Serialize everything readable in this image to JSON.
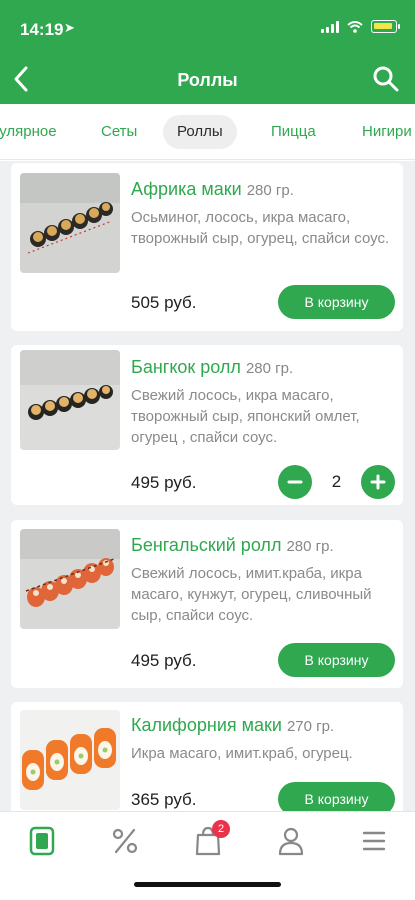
{
  "status": {
    "time": "14:19"
  },
  "header": {
    "title": "Роллы",
    "back_icon": "chevron-left-icon",
    "search_icon": "search-icon"
  },
  "tabs": [
    {
      "label": "Популярное"
    },
    {
      "label": "Сеты"
    },
    {
      "label": "Роллы",
      "active": true
    },
    {
      "label": "Пицца"
    },
    {
      "label": "Нигири"
    }
  ],
  "products": [
    {
      "name": "Африка маки",
      "weight": "280 гр.",
      "description": "Осьминог, лосось, икра масаго, творожный сыр, огурец, спайси соус.",
      "price": "505 руб.",
      "action": "В корзину"
    },
    {
      "name": "Бангкок ролл",
      "weight": "280 гр.",
      "description": "Свежий лосось, икра масаго, творожный сыр, японский омлет, огурец , спайси соус.",
      "price": "495 руб.",
      "quantity": "2"
    },
    {
      "name": "Бенгальский ролл",
      "weight": "280 гр.",
      "description": "Свежий лосось, имит.краба, икра масаго, кунжут, огурец, сливочный сыр, спайси соус.",
      "price": "495 руб.",
      "action": "В корзину"
    },
    {
      "name": "Калифорния маки",
      "weight": "270 гр.",
      "description": "Икра масаго, имит.краб, огурец.",
      "price": "365 руб.",
      "action": "В корзину"
    }
  ],
  "tabbar": {
    "items": [
      {
        "icon": "menu-book-icon",
        "active": true
      },
      {
        "icon": "percent-icon"
      },
      {
        "icon": "shopping-bag-icon",
        "badge": "2"
      },
      {
        "icon": "profile-icon"
      },
      {
        "icon": "hamburger-menu-icon"
      }
    ]
  },
  "colors": {
    "accent": "#2fa84f",
    "badge": "#e8334a",
    "background": "#eef0f2"
  }
}
